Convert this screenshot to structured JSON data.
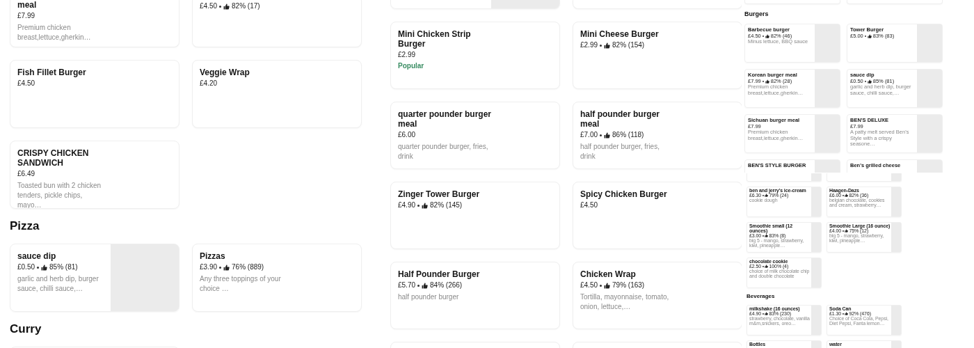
{
  "panels": [
    {
      "blocks": [
        {
          "kind": "row",
          "items": [
            {
              "title": "meal",
              "price": "£7.99",
              "desc": "Premium chicken breast,lettuce,gherkin…",
              "has_image": false
            },
            {
              "price": "£4.50",
              "rating": "82% (17)",
              "has_image": false
            }
          ]
        },
        {
          "kind": "row",
          "items": [
            {
              "title": "Fish Fillet Burger",
              "price": "£4.50",
              "has_image": false
            },
            {
              "title": "Veggie Wrap",
              "price": "£4.20",
              "has_image": false
            }
          ]
        },
        {
          "kind": "row",
          "items": [
            {
              "title": "CRISPY CHICKEN SANDWICH",
              "price": "£6.49",
              "desc": "Toasted bun with 2 chicken tenders, pickle chips, mayo…",
              "has_image": false
            }
          ]
        },
        {
          "kind": "heading",
          "text": "Pizza"
        },
        {
          "kind": "row",
          "items": [
            {
              "title": "sauce dip",
              "price": "£0.50",
              "rating": "85% (81)",
              "desc": "garlic and herb dip, burger sauce, chilli sauce,…",
              "has_image": true
            },
            {
              "title": "Pizzas",
              "price": "£3.90",
              "rating": "76% (889)",
              "desc": "Any three toppings of your choice …",
              "has_image": false
            }
          ]
        },
        {
          "kind": "heading",
          "text": "Curry"
        },
        {
          "kind": "row",
          "items": [
            {
              "has_image": false
            }
          ]
        }
      ]
    },
    {
      "blocks": [
        {
          "kind": "row",
          "items": [
            {
              "has_image": true
            },
            {
              "has_image": false
            }
          ]
        },
        {
          "kind": "row",
          "items": [
            {
              "title": "Mini Chicken Strip Burger",
              "price": "£2.99",
              "badge": "Popular",
              "has_image": false
            },
            {
              "title": "Mini Cheese Burger",
              "price": "£2.99",
              "rating": "82% (154)",
              "has_image": false
            }
          ]
        },
        {
          "kind": "row",
          "items": [
            {
              "title": "quarter pounder burger meal",
              "price": "£6.00",
              "desc": "quarter pounder burger, fries, drink",
              "has_image": false
            },
            {
              "title": "half pounder burger meal",
              "price": "£7.00",
              "rating": "86% (118)",
              "desc": "half pounder burger, fries, drink",
              "has_image": false
            }
          ]
        },
        {
          "kind": "row",
          "items": [
            {
              "title": "Zinger Tower Burger",
              "price": "£4.90",
              "rating": "82% (145)",
              "has_image": false
            },
            {
              "title": "Spicy Chicken Burger",
              "price": "£4.50",
              "has_image": false
            }
          ]
        },
        {
          "kind": "row",
          "items": [
            {
              "title": "Half Pounder Burger",
              "price": "£5.70",
              "rating": "84% (266)",
              "desc": "half pounder burger",
              "has_image": false
            },
            {
              "title": "Chicken Wrap",
              "price": "£4.50",
              "rating": "79% (163)",
              "desc": "Tortilla, mayonnaise, tomato, onion, lettuce,…",
              "has_image": false
            }
          ]
        },
        {
          "kind": "row",
          "items": [
            {
              "has_image": false
            },
            {
              "has_image": false
            }
          ]
        }
      ]
    },
    {
      "blocks": [
        {
          "kind": "row",
          "items": [
            {
              "has_image": false
            },
            {
              "has_image": false
            }
          ]
        },
        {
          "kind": "heading",
          "text": "Burgers"
        },
        {
          "kind": "row",
          "items": [
            {
              "title": "Barbecue burger",
              "price": "£4.50",
              "rating": "82% (46)",
              "desc": "Minus lettuce, BBQ sauce",
              "has_image": true
            },
            {
              "title": "Tower Burger",
              "price": "£5.00",
              "rating": "83% (83)",
              "has_image": true
            }
          ]
        },
        {
          "kind": "row",
          "items": [
            {
              "title": "Korean burger meal",
              "price": "£7.99",
              "rating": "82% (28)",
              "desc": "Premium chicken breast,lettuce,gherkin…",
              "has_image": true
            },
            {
              "title": "sauce dip",
              "price": "£0.50",
              "rating": "85% (81)",
              "desc": "garlic and herb dip, burger sauce, chilli sauce,…",
              "has_image": true
            }
          ]
        },
        {
          "kind": "row",
          "items": [
            {
              "title": "Sichuan burger meal",
              "price": "£7.99",
              "desc": "Premium chicken breast,lettuce,gherkin…",
              "has_image": true
            },
            {
              "title": "BEN'S DELUXE",
              "price": "£7.99",
              "desc": "A patty melt served Ben's Style with a crispy seasone…",
              "has_image": true
            }
          ]
        },
        {
          "kind": "row",
          "items": [
            {
              "title": "BEN'S STYLE BURGER",
              "has_image": true
            },
            {
              "title": "Ben's grilled cheese",
              "has_image": true
            }
          ]
        }
      ]
    },
    {
      "blocks": [
        {
          "kind": "row",
          "items": [
            {
              "has_image": true
            },
            {
              "has_image": true
            }
          ]
        },
        {
          "kind": "row",
          "items": [
            {
              "title": "ben and jerry's ice-cream",
              "price": "£6.30",
              "rating": "79% (24)",
              "desc": "cookie dough",
              "has_image": true
            },
            {
              "title": "Haagen-Dazs",
              "price": "£6.00",
              "rating": "82% (36)",
              "desc": "belgian chocolate, cookies and cream, strawberry…",
              "has_image": true
            }
          ]
        },
        {
          "kind": "row",
          "items": [
            {
              "title": "Smoothie small (12 ounces)",
              "price": "£3.00",
              "rating": "83% (8)",
              "desc": "big 5 - mango, strawberry, kiwi, pineapple…",
              "has_image": true
            },
            {
              "title": "Smoothie Large (16 ounce)",
              "price": "£4.00",
              "rating": "75% (12)",
              "desc": "big 5 - mango, strawberry, kiwi, pineapple…",
              "has_image": true
            }
          ]
        },
        {
          "kind": "row",
          "items": [
            {
              "title": "chocolate cookie",
              "price": "£2.50",
              "rating": "100% (4)",
              "desc": "choice of milk chocolate chip and double chocolate",
              "has_image": true
            }
          ]
        },
        {
          "kind": "heading",
          "text": "Beverages"
        },
        {
          "kind": "row",
          "items": [
            {
              "title": "milkshake (16 ounces)",
              "price": "£4.90",
              "rating": "83% (230)",
              "desc": "strawberry, chocolate, vanilla m&m,snickers, oreo…",
              "has_image": true
            },
            {
              "title": "Soda Can",
              "price": "£1.30",
              "rating": "92% (476)",
              "desc": "Choice of Coca Cola, Pepsi, Diet Pepsi, Fanta lemon…",
              "has_image": true
            }
          ]
        },
        {
          "kind": "row",
          "items": [
            {
              "title": "Bottles",
              "has_image": true
            },
            {
              "title": "water",
              "has_image": true
            }
          ]
        }
      ]
    }
  ]
}
